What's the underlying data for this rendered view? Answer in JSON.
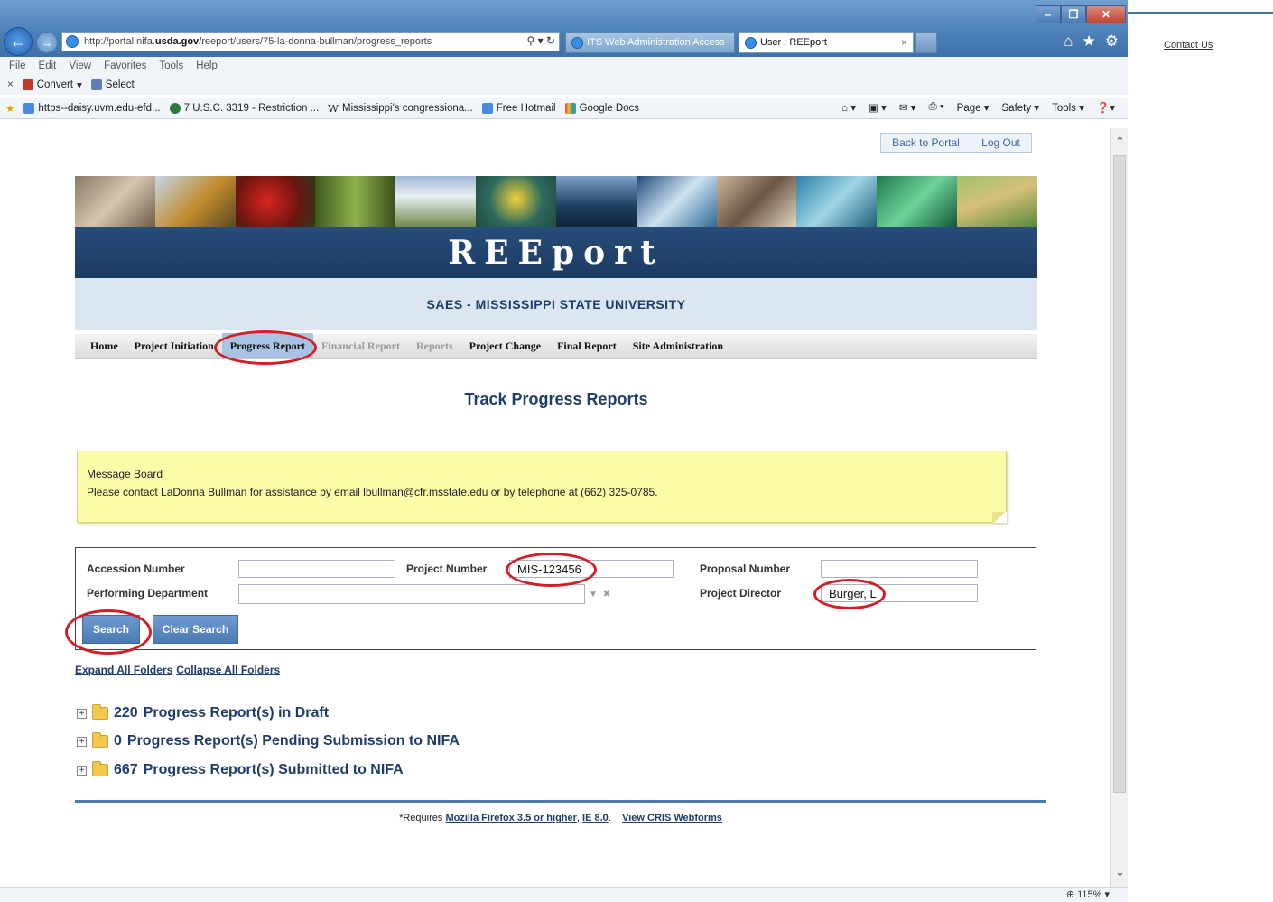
{
  "browser": {
    "url_prefix": "http://portal.nifa.",
    "url_host": "usda.gov",
    "url_path": "/reeport/users/75-la-donna-bullman/progress_reports",
    "tabs": [
      "ITS Web Administration Access",
      "User : REEport"
    ],
    "tab_close": "×",
    "menu": [
      "File",
      "Edit",
      "View",
      "Favorites",
      "Tools",
      "Help"
    ],
    "command_bar": [
      "Convert",
      "Select"
    ],
    "favorites": [
      "https--daisy.uvm.edu-efd...",
      "7 U.S.C. 3319 - Restriction ...",
      "Mississippi's congressiona...",
      "Free Hotmail",
      "Google Docs"
    ],
    "fav_tools": [
      "Page ▾",
      "Safety ▾",
      "Tools ▾"
    ],
    "zoom": "115%"
  },
  "outside": {
    "contact_us": "Contact Us"
  },
  "top_links": {
    "back_to_portal": "Back to Portal",
    "log_out": "Log Out"
  },
  "banner": {
    "title": "REEport",
    "institution": "SAES - MISSISSIPPI STATE UNIVERSITY"
  },
  "nav": [
    {
      "label": "Home",
      "state": "normal"
    },
    {
      "label": "Project Initiation",
      "state": "normal"
    },
    {
      "label": "Progress Report",
      "state": "active"
    },
    {
      "label": "Financial Report",
      "state": "disabled"
    },
    {
      "label": "Reports",
      "state": "disabled"
    },
    {
      "label": "Project Change",
      "state": "normal"
    },
    {
      "label": "Final Report",
      "state": "normal"
    },
    {
      "label": "Site Administration",
      "state": "normal"
    }
  ],
  "page_title": "Track Progress Reports",
  "message_board": {
    "heading": "Message Board",
    "text": "Please contact LaDonna Bullman for assistance by email lbullman@cfr.msstate.edu or by telephone at (662) 325-0785."
  },
  "search": {
    "accession_label": "Accession Number",
    "accession_value": "",
    "project_number_label": "Project Number",
    "project_number_value": "MIS-123456",
    "proposal_label": "Proposal Number",
    "proposal_value": "",
    "department_label": "Performing Department",
    "department_value": "",
    "director_label": "Project Director",
    "director_value": "Burger, L",
    "search_button": "Search",
    "clear_button": "Clear Search"
  },
  "folders": {
    "expand_all": "Expand All Folders",
    "collapse_all": "Collapse All Folders",
    "items": [
      {
        "count": "220",
        "label": "Progress Report(s) in Draft"
      },
      {
        "count": "0",
        "label": "Progress Report(s) Pending Submission to NIFA"
      },
      {
        "count": "667",
        "label": "Progress Report(s) Submitted to NIFA"
      }
    ]
  },
  "footer": {
    "requires": "*Requires",
    "firefox": "Mozilla Firefox 3.5 or higher",
    "ie": "IE 8.0",
    "cris": "View CRIS Webforms"
  },
  "colors": {
    "brand_navy": "#1f3d6b",
    "accent_blue": "#4a79b3",
    "annotation_red": "#d21f26",
    "message_yellow": "#fdfaa8"
  },
  "icons": [
    "back-arrow-icon",
    "forward-arrow-icon",
    "ie-icon",
    "search-icon",
    "refresh-icon",
    "home-icon",
    "star-icon",
    "gear-icon",
    "folder-icon",
    "expand-plus-icon"
  ]
}
